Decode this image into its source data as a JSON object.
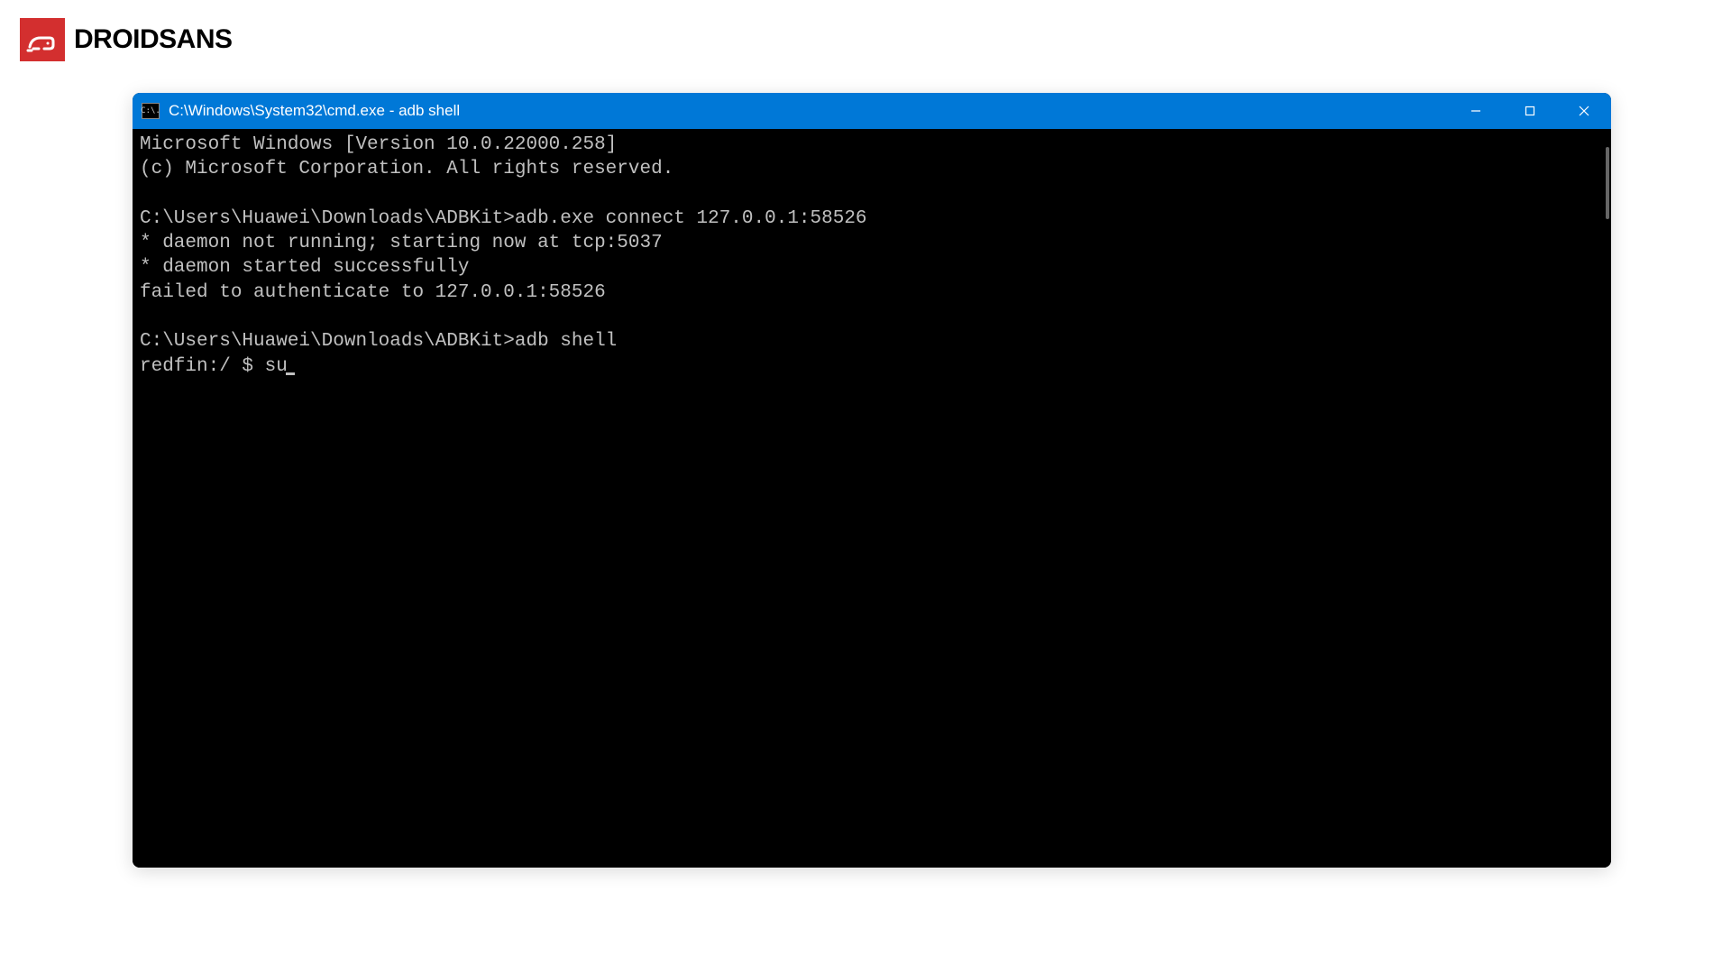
{
  "watermark": {
    "brand": "DROIDSANS"
  },
  "window": {
    "title": "C:\\Windows\\System32\\cmd.exe - adb  shell",
    "icon_label": "C:\\."
  },
  "terminal": {
    "lines": [
      "Microsoft Windows [Version 10.0.22000.258]",
      "(c) Microsoft Corporation. All rights reserved.",
      "",
      "C:\\Users\\Huawei\\Downloads\\ADBKit>adb.exe connect 127.0.0.1:58526",
      "* daemon not running; starting now at tcp:5037",
      "* daemon started successfully",
      "failed to authenticate to 127.0.0.1:58526",
      "",
      "C:\\Users\\Huawei\\Downloads\\ADBKit>adb shell",
      "redfin:/ $ su"
    ]
  }
}
